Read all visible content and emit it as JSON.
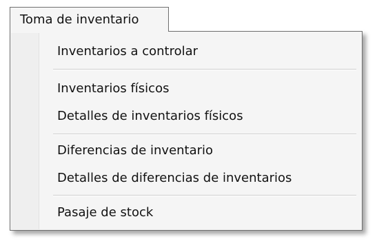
{
  "menu": {
    "title": "Toma de inventario",
    "items": [
      {
        "label": "Inventarios a controlar"
      },
      {
        "label": "Inventarios físicos"
      },
      {
        "label": "Detalles de inventarios físicos"
      },
      {
        "label": "Diferencias de inventario"
      },
      {
        "label": "Detalles de diferencias de inventarios"
      },
      {
        "label": "Pasaje de stock"
      }
    ]
  },
  "colors": {
    "menu_background": "#f5f5f5",
    "border": "#6e6e6e",
    "separator": "#cfcfcf",
    "text": "#111111"
  }
}
